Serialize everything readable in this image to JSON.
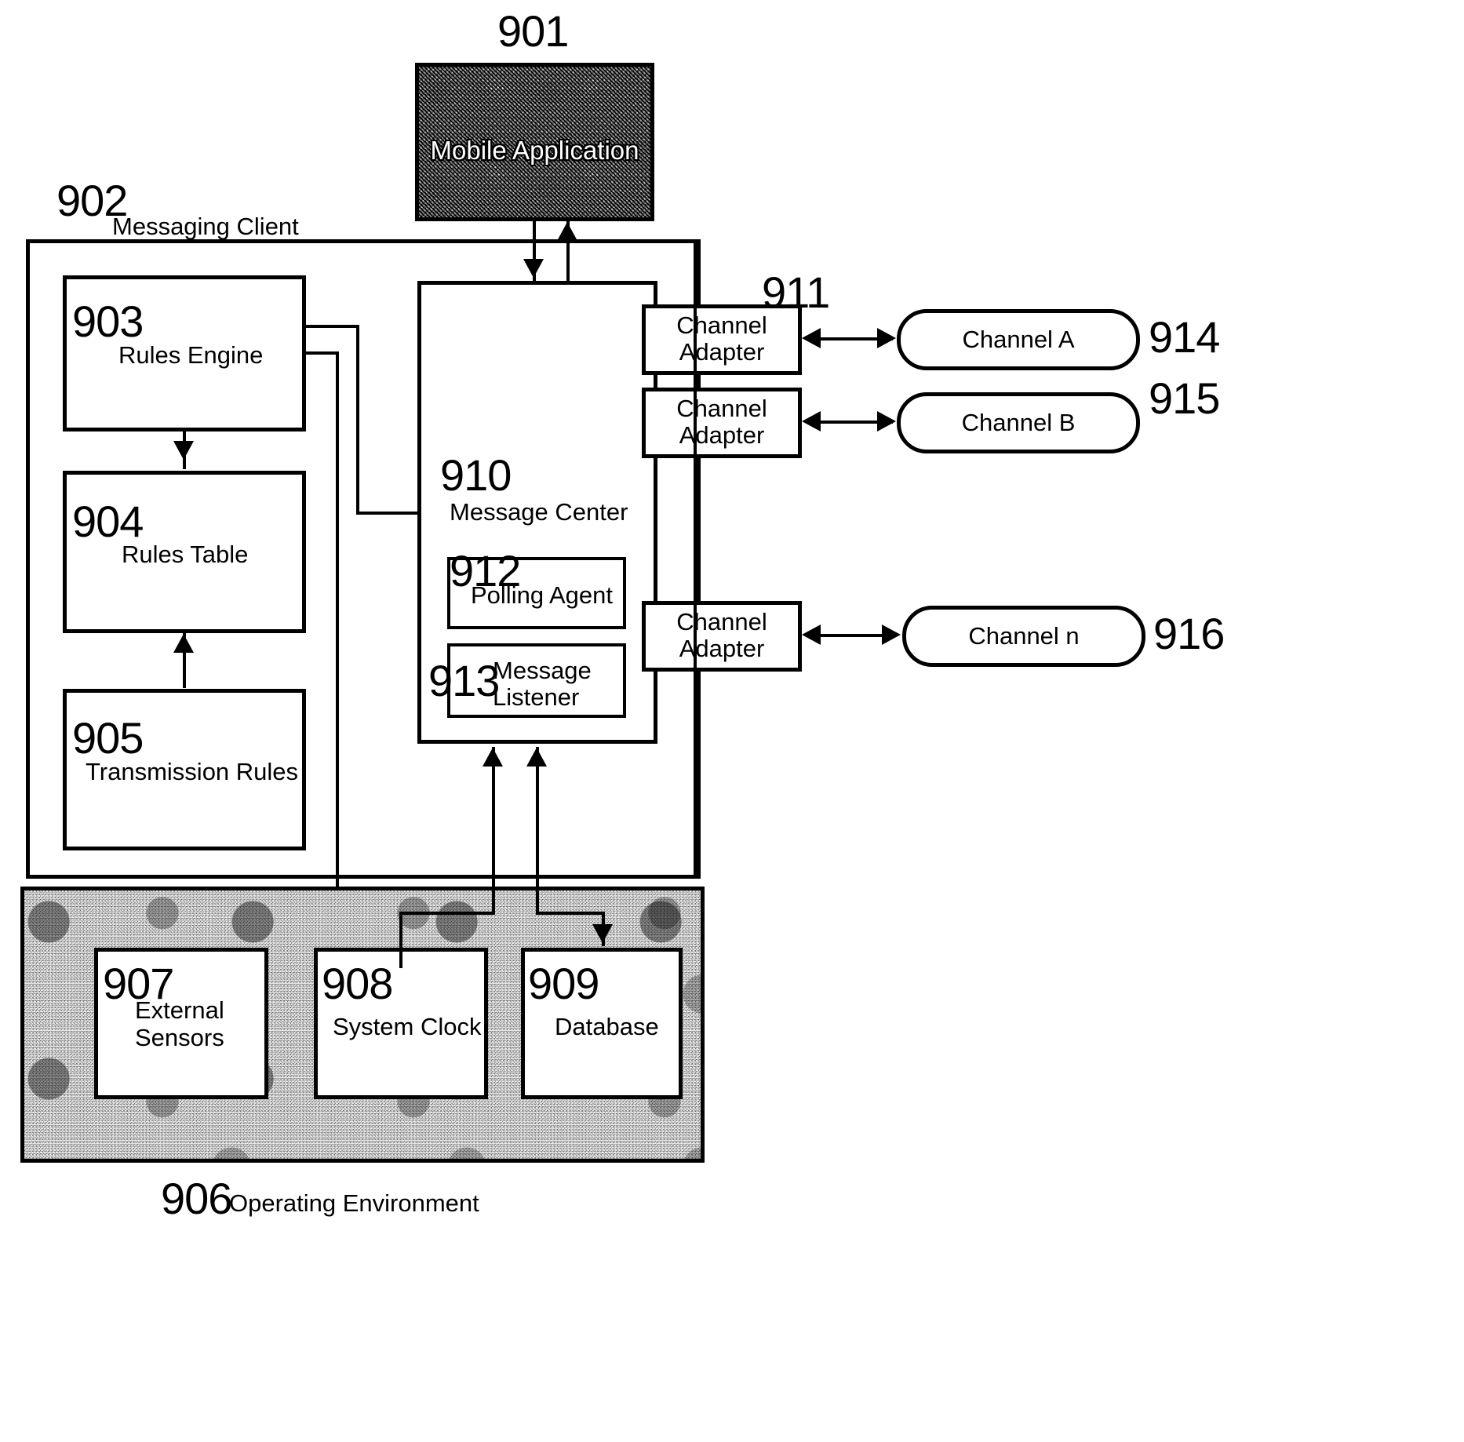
{
  "figure": {
    "mobile_application": {
      "ref": "901",
      "label": "Mobile Application"
    },
    "messaging_client": {
      "ref": "902",
      "label": "Messaging Client"
    },
    "rules_engine": {
      "ref": "903",
      "label": "Rules Engine"
    },
    "rules_table": {
      "ref": "904",
      "label": "Rules Table"
    },
    "transmission_rules": {
      "ref": "905",
      "label": "Transmission Rules"
    },
    "operating_environment": {
      "ref": "906",
      "label": "Operating Environment"
    },
    "external_sensors": {
      "ref": "907",
      "label_line1": "External",
      "label_line2": "Sensors"
    },
    "system_clock": {
      "ref": "908",
      "label": "System Clock"
    },
    "database": {
      "ref": "909",
      "label": "Database"
    },
    "message_center": {
      "ref": "910",
      "label": "Message Center"
    },
    "channel_adapter_ref": {
      "ref": "911"
    },
    "polling_agent": {
      "ref": "912",
      "label": "Polling Agent"
    },
    "message_listener": {
      "ref": "913",
      "label_line1": "Message",
      "label_line2": "Listener"
    },
    "channel_adapters": [
      {
        "line1": "Channel",
        "line2": "Adapter"
      },
      {
        "line1": "Channel",
        "line2": "Adapter"
      },
      {
        "line1": "Channel",
        "line2": "Adapter"
      }
    ],
    "channels": [
      {
        "ref": "914",
        "label": "Channel A"
      },
      {
        "ref": "915",
        "label": "Channel B"
      },
      {
        "ref": "916",
        "label": "Channel  n"
      }
    ]
  },
  "colors": {
    "line": "#000000",
    "page_background": "#ffffff",
    "mobile_app_fill": "#3a3a3a",
    "operating_environment_fill": "#e6e6e6"
  }
}
